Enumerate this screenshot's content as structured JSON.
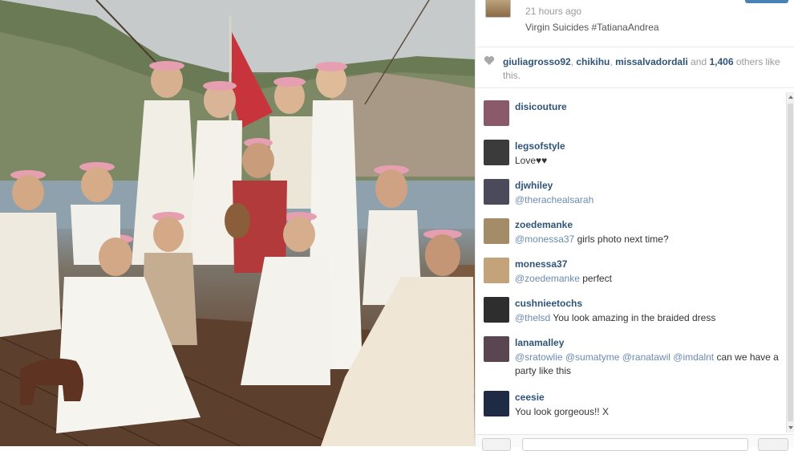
{
  "post": {
    "time": "21 hours ago",
    "caption": "Virgin Suicides #TatianaAndrea"
  },
  "likes": {
    "users": [
      "giuliagrosso92",
      "chikihu",
      "missalvadordali"
    ],
    "sep1": ", ",
    "sep2": ", ",
    "and_text": " and ",
    "count": "1,406",
    "rest": " others like this."
  },
  "comments": [
    {
      "user": "disicouture",
      "mention": "",
      "text": "",
      "avatar_color": "#8a5a6a"
    },
    {
      "user": "legsofstyle",
      "mention": "",
      "text": "Love♥♥",
      "avatar_color": "#3b3b3b"
    },
    {
      "user": "djwhiley",
      "mention": "@therachealsarah",
      "text": "",
      "avatar_color": "#4a4a5a"
    },
    {
      "user": "zoedemanke",
      "mention": "@monessa37",
      "text": " girls photo next time?",
      "avatar_color": "#a48c68"
    },
    {
      "user": "monessa37",
      "mention": "@zoedemanke",
      "text": " perfect",
      "avatar_color": "#c4a27a"
    },
    {
      "user": "cushnieetochs",
      "mention": "@thelsd",
      "text": " You look amazing in the braided dress",
      "avatar_color": "#2e2e2e"
    },
    {
      "user": "lanamalley",
      "mention": "@sratowlie @sumatyme @ranatawil @imdalnt",
      "text": " can we have a party like this",
      "avatar_color": "#5a4650"
    },
    {
      "user": "ceesie",
      "mention": "",
      "text": "You look gorgeous!! X",
      "avatar_color": "#1f2a44"
    }
  ],
  "colors": {
    "link": "#2f5478",
    "mention": "#6b8bb0",
    "muted": "#9a9a9a",
    "accent_button": "#4a82b8"
  },
  "icons": {
    "like": "heart-icon"
  }
}
